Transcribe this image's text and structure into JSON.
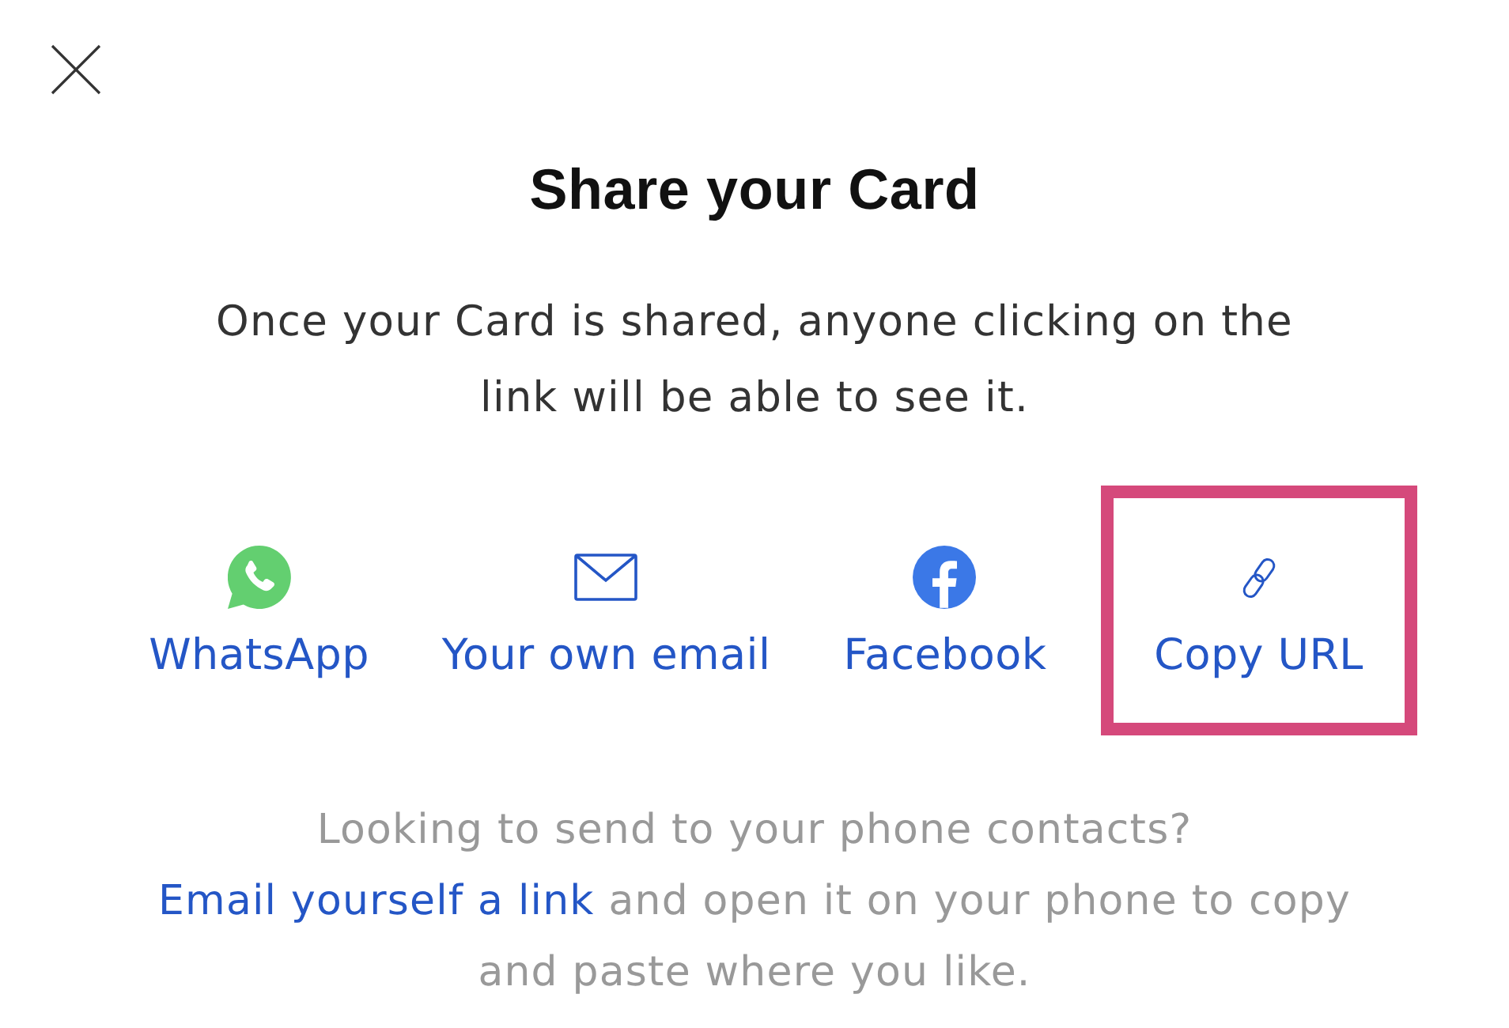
{
  "dialog": {
    "title": "Share your Card",
    "description": "Once your Card is shared, anyone clicking on the link will be able to see it."
  },
  "share_options": [
    {
      "kind": "whatsapp",
      "label": "WhatsApp",
      "highlighted": false
    },
    {
      "kind": "email",
      "label": "Your own email",
      "highlighted": false
    },
    {
      "kind": "facebook",
      "label": "Facebook",
      "highlighted": false
    },
    {
      "kind": "link",
      "label": "Copy URL",
      "highlighted": true
    }
  ],
  "footer": {
    "question": "Looking to send to your phone contacts?",
    "link": "Email yourself a link",
    "text": "and open it on your phone to copy and paste where you like."
  }
}
